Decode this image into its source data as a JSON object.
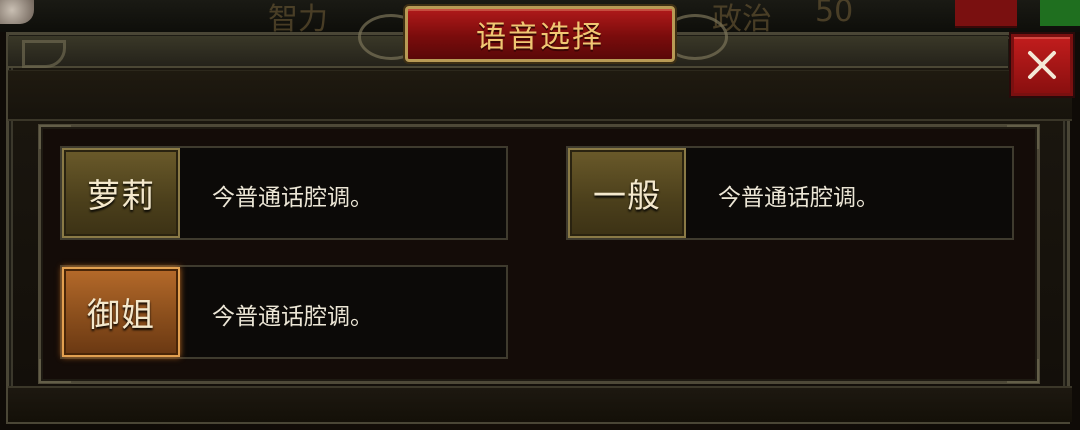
{
  "dialog": {
    "title": "语音选择",
    "close_symbol": "X"
  },
  "hud": {
    "left_text": "智力",
    "right_text": "政治",
    "right_value": "50"
  },
  "options": [
    {
      "label": "萝莉",
      "description": "今普通话腔调。",
      "selected": false
    },
    {
      "label": "一般",
      "description": "今普通话腔调。",
      "selected": false
    },
    {
      "label": "御姐",
      "description": "今普通话腔调。",
      "selected": true
    }
  ],
  "colors": {
    "title_bg": "#7a0c0c",
    "title_text": "#f0c773",
    "close_bg": "#c21d1d",
    "button_normal": "#5a4b22",
    "button_selected": "#8a4e1c"
  }
}
